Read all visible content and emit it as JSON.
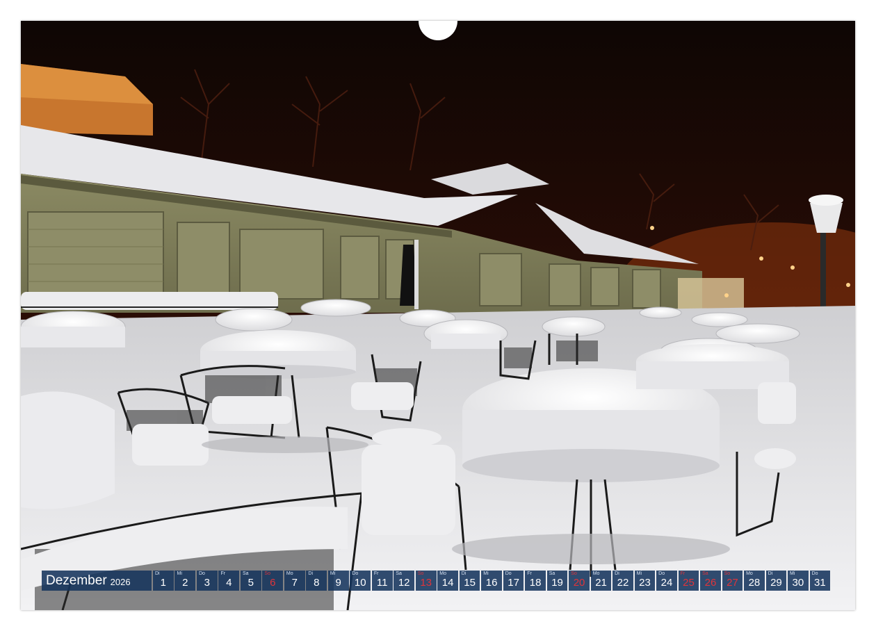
{
  "calendar": {
    "month": "Dezember",
    "year": "2026",
    "colors": {
      "cell_bg": "#16345c",
      "text": "#ffffff",
      "holiday": "#e0343a"
    },
    "days": [
      {
        "wd": "Di",
        "num": "1",
        "red": false
      },
      {
        "wd": "Mi",
        "num": "2",
        "red": false
      },
      {
        "wd": "Do",
        "num": "3",
        "red": false
      },
      {
        "wd": "Fr",
        "num": "4",
        "red": false
      },
      {
        "wd": "Sa",
        "num": "5",
        "red": false
      },
      {
        "wd": "So",
        "num": "6",
        "red": true
      },
      {
        "wd": "Mo",
        "num": "7",
        "red": false
      },
      {
        "wd": "Di",
        "num": "8",
        "red": false
      },
      {
        "wd": "Mi",
        "num": "9",
        "red": false
      },
      {
        "wd": "Do",
        "num": "10",
        "red": false
      },
      {
        "wd": "Fr",
        "num": "11",
        "red": false
      },
      {
        "wd": "Sa",
        "num": "12",
        "red": false
      },
      {
        "wd": "So",
        "num": "13",
        "red": true
      },
      {
        "wd": "Mo",
        "num": "14",
        "red": false
      },
      {
        "wd": "Di",
        "num": "15",
        "red": false
      },
      {
        "wd": "Mi",
        "num": "16",
        "red": false
      },
      {
        "wd": "Do",
        "num": "17",
        "red": false
      },
      {
        "wd": "Fr",
        "num": "18",
        "red": false
      },
      {
        "wd": "Sa",
        "num": "19",
        "red": false
      },
      {
        "wd": "So",
        "num": "20",
        "red": true
      },
      {
        "wd": "Mo",
        "num": "21",
        "red": false
      },
      {
        "wd": "Di",
        "num": "22",
        "red": false
      },
      {
        "wd": "Mi",
        "num": "23",
        "red": false
      },
      {
        "wd": "Do",
        "num": "24",
        "red": false
      },
      {
        "wd": "Fr",
        "num": "25",
        "red": true
      },
      {
        "wd": "Sa",
        "num": "26",
        "red": true
      },
      {
        "wd": "So",
        "num": "27",
        "red": true
      },
      {
        "wd": "Mo",
        "num": "28",
        "red": false
      },
      {
        "wd": "Di",
        "num": "29",
        "red": false
      },
      {
        "wd": "Mi",
        "num": "30",
        "red": false
      },
      {
        "wd": "Do",
        "num": "31",
        "red": false
      }
    ]
  },
  "photo": {
    "subject": "snow-covered-cafe-terrace-at-night"
  }
}
